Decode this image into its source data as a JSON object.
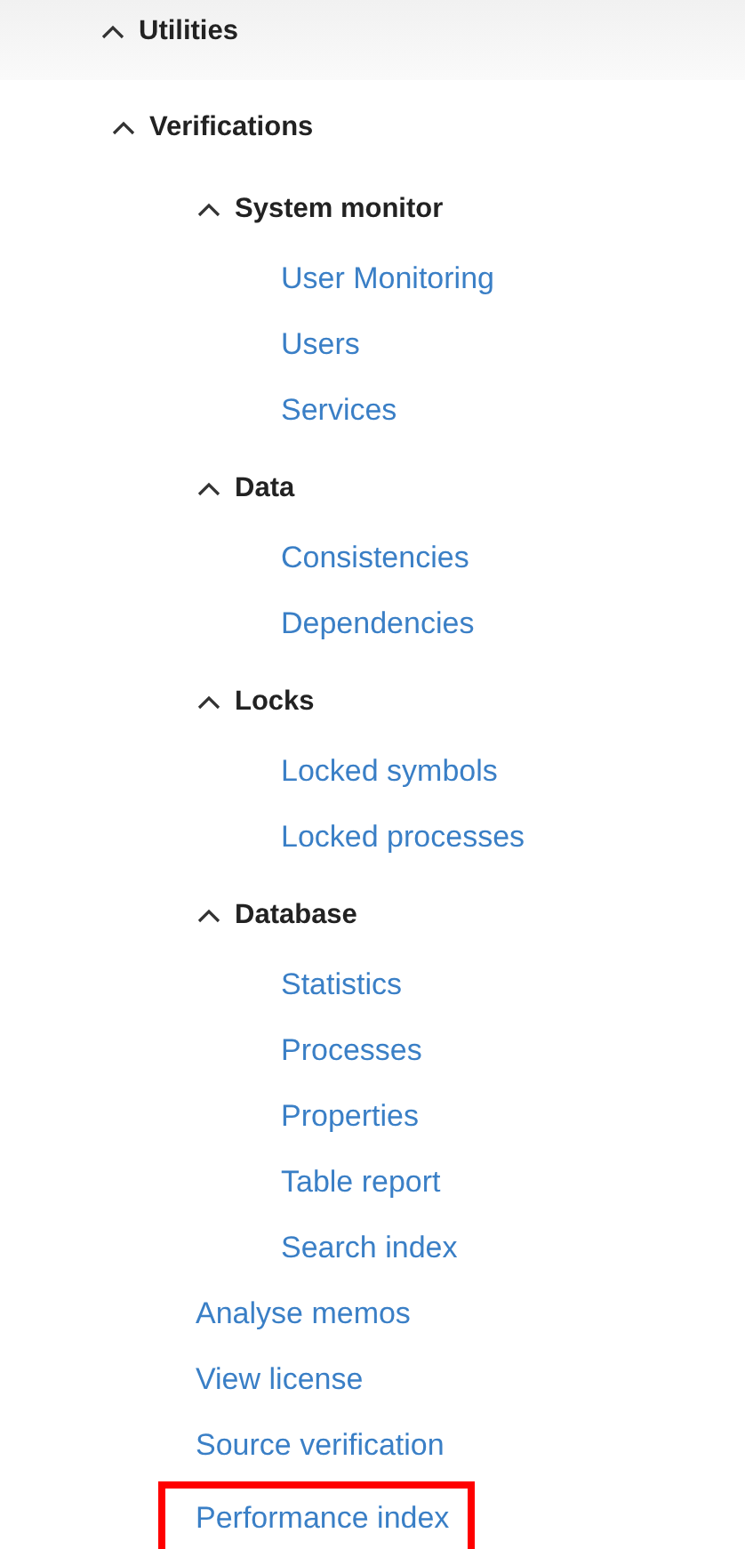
{
  "tree": [
    {
      "kind": "group",
      "label": "Utilities",
      "expanded": true,
      "children": [
        {
          "kind": "group",
          "label": "Verifications",
          "expanded": true,
          "children": [
            {
              "kind": "group",
              "label": "System monitor",
              "expanded": true,
              "children": [
                {
                  "kind": "link",
                  "label": "User Monitoring",
                  "highlighted": false
                },
                {
                  "kind": "link",
                  "label": "Users",
                  "highlighted": false
                },
                {
                  "kind": "link",
                  "label": "Services",
                  "highlighted": false
                }
              ]
            },
            {
              "kind": "group",
              "label": "Data",
              "expanded": true,
              "children": [
                {
                  "kind": "link",
                  "label": "Consistencies",
                  "highlighted": false
                },
                {
                  "kind": "link",
                  "label": "Dependencies",
                  "highlighted": false
                }
              ]
            },
            {
              "kind": "group",
              "label": "Locks",
              "expanded": true,
              "children": [
                {
                  "kind": "link",
                  "label": "Locked symbols",
                  "highlighted": false
                },
                {
                  "kind": "link",
                  "label": "Locked processes",
                  "highlighted": false
                }
              ]
            },
            {
              "kind": "group",
              "label": "Database",
              "expanded": true,
              "children": [
                {
                  "kind": "link",
                  "label": "Statistics",
                  "highlighted": false
                },
                {
                  "kind": "link",
                  "label": "Processes",
                  "highlighted": false
                },
                {
                  "kind": "link",
                  "label": "Properties",
                  "highlighted": false
                },
                {
                  "kind": "link",
                  "label": "Table report",
                  "highlighted": false
                },
                {
                  "kind": "link",
                  "label": "Search index",
                  "highlighted": false
                }
              ]
            },
            {
              "kind": "link",
              "label": "Analyse memos",
              "highlighted": false
            },
            {
              "kind": "link",
              "label": "View license",
              "highlighted": false
            },
            {
              "kind": "link",
              "label": "Source verification",
              "highlighted": false
            },
            {
              "kind": "link",
              "label": "Performance index",
              "highlighted": true
            }
          ]
        }
      ]
    }
  ]
}
